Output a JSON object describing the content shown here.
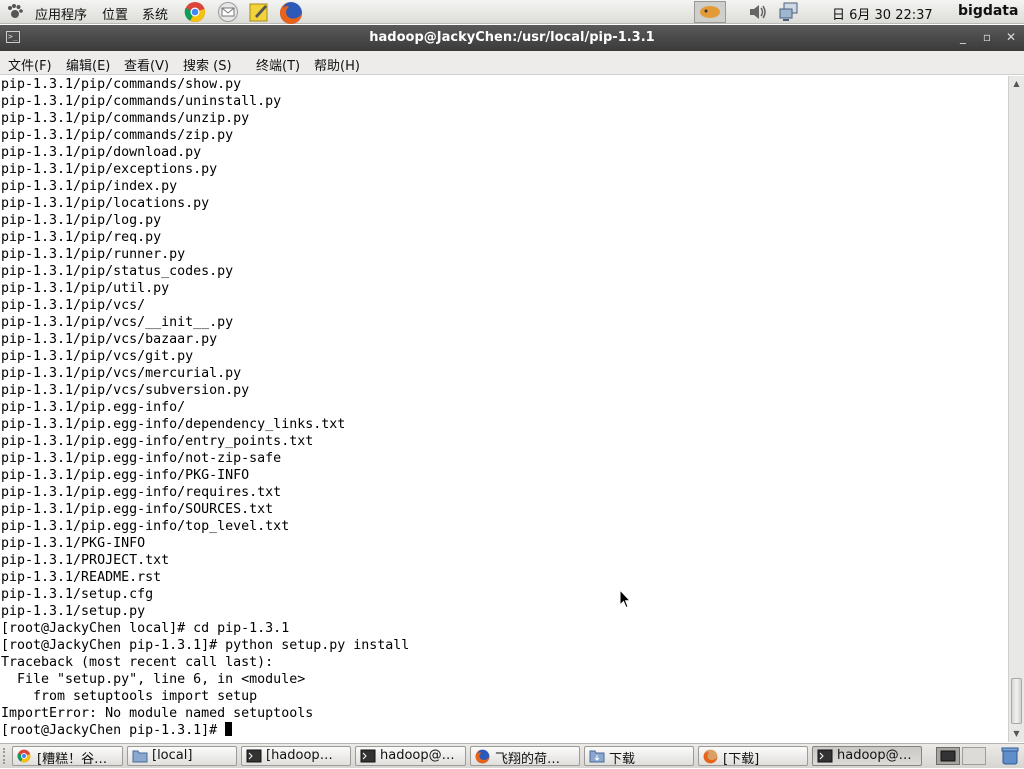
{
  "top_panel": {
    "menus": [
      "应用程序",
      "位置",
      "系统"
    ],
    "launchers": [
      "chrome-icon",
      "mail-icon",
      "notes-icon",
      "firefox-icon"
    ],
    "clock": "日 6月 30 22:37",
    "hostname": "bigdata"
  },
  "window": {
    "title": "hadoop@JackyChen:/usr/local/pip-1.3.1"
  },
  "menubar": [
    "文件(F)",
    "编辑(E)",
    "查看(V)",
    "搜索 (S)",
    "终端(T)",
    "帮助(H)"
  ],
  "terminal": {
    "lines": [
      "pip-1.3.1/pip/commands/show.py",
      "pip-1.3.1/pip/commands/uninstall.py",
      "pip-1.3.1/pip/commands/unzip.py",
      "pip-1.3.1/pip/commands/zip.py",
      "pip-1.3.1/pip/download.py",
      "pip-1.3.1/pip/exceptions.py",
      "pip-1.3.1/pip/index.py",
      "pip-1.3.1/pip/locations.py",
      "pip-1.3.1/pip/log.py",
      "pip-1.3.1/pip/req.py",
      "pip-1.3.1/pip/runner.py",
      "pip-1.3.1/pip/status_codes.py",
      "pip-1.3.1/pip/util.py",
      "pip-1.3.1/pip/vcs/",
      "pip-1.3.1/pip/vcs/__init__.py",
      "pip-1.3.1/pip/vcs/bazaar.py",
      "pip-1.3.1/pip/vcs/git.py",
      "pip-1.3.1/pip/vcs/mercurial.py",
      "pip-1.3.1/pip/vcs/subversion.py",
      "pip-1.3.1/pip.egg-info/",
      "pip-1.3.1/pip.egg-info/dependency_links.txt",
      "pip-1.3.1/pip.egg-info/entry_points.txt",
      "pip-1.3.1/pip.egg-info/not-zip-safe",
      "pip-1.3.1/pip.egg-info/PKG-INFO",
      "pip-1.3.1/pip.egg-info/requires.txt",
      "pip-1.3.1/pip.egg-info/SOURCES.txt",
      "pip-1.3.1/pip.egg-info/top_level.txt",
      "pip-1.3.1/PKG-INFO",
      "pip-1.3.1/PROJECT.txt",
      "pip-1.3.1/README.rst",
      "pip-1.3.1/setup.cfg",
      "pip-1.3.1/setup.py",
      "[root@JackyChen local]# cd pip-1.3.1",
      "[root@JackyChen pip-1.3.1]# python setup.py install",
      "Traceback (most recent call last):",
      "  File \"setup.py\", line 6, in <module>",
      "    from setuptools import setup",
      "ImportError: No module named setuptools"
    ],
    "prompt": "[root@JackyChen pip-1.3.1]# "
  },
  "taskbar": {
    "tasks": [
      {
        "label": "[糟糕！谷…",
        "icon": "chrome-icon"
      },
      {
        "label": "[local]",
        "icon": "folder-icon"
      },
      {
        "label": "[hadoop…",
        "icon": "terminal-icon"
      },
      {
        "label": "hadoop@…",
        "icon": "terminal-icon"
      },
      {
        "label": "飞翔的荷…",
        "icon": "firefox-icon"
      },
      {
        "label": "下载",
        "icon": "download-folder-icon"
      },
      {
        "label": "[下载]",
        "icon": "firefox-icon"
      },
      {
        "label": "hadoop@…",
        "icon": "terminal-icon"
      }
    ]
  }
}
